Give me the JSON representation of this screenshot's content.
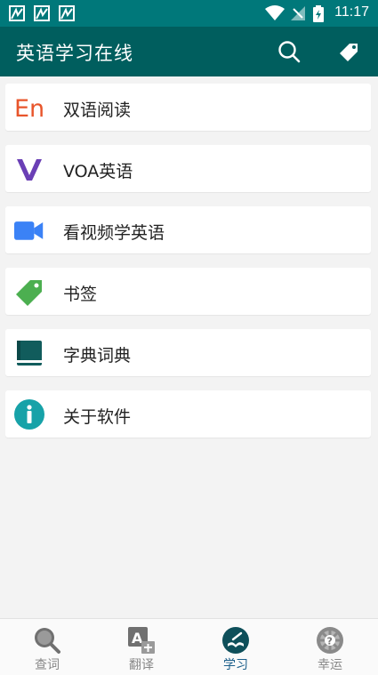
{
  "status_bar": {
    "time": "11:17"
  },
  "app_bar": {
    "title": "英语学习在线"
  },
  "menu": [
    {
      "label": "双语阅读",
      "icon": "en-logo-icon"
    },
    {
      "label": "VOA英语",
      "icon": "voa-logo-icon"
    },
    {
      "label": "看视频学英语",
      "icon": "video-camera-icon"
    },
    {
      "label": "书签",
      "icon": "bookmark-tag-icon"
    },
    {
      "label": "字典词典",
      "icon": "book-icon"
    },
    {
      "label": "关于软件",
      "icon": "info-icon"
    }
  ],
  "bottom_nav": [
    {
      "label": "查词",
      "icon": "search-icon",
      "active": false
    },
    {
      "label": "翻译",
      "icon": "translate-icon",
      "active": false
    },
    {
      "label": "学习",
      "icon": "study-icon",
      "active": true
    },
    {
      "label": "幸运",
      "icon": "lucky-wheel-icon",
      "active": false
    }
  ],
  "colors": {
    "status_bar": "#00787a",
    "app_bar": "#005e5e",
    "background": "#f3f3f3",
    "active_tab": "#1b5e8a"
  }
}
